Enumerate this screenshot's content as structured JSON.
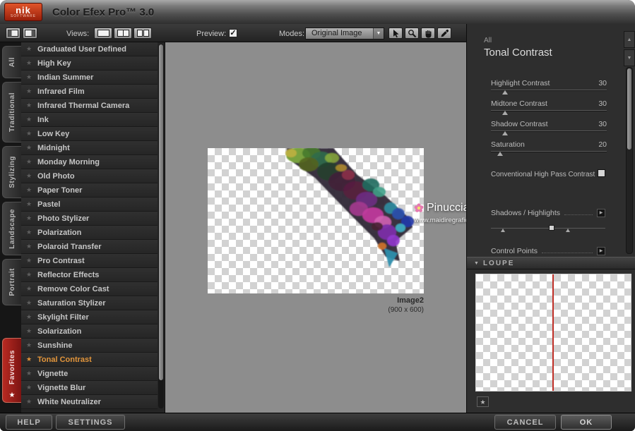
{
  "titlebar": {
    "logo_main": "nik",
    "logo_sub": "software",
    "title": "Color Efex Pro™ 3.0"
  },
  "toolbar": {
    "views_label": "Views:",
    "preview_label": "Preview:",
    "modes_label": "Modes:",
    "modes_value": "Original Image"
  },
  "icons": {
    "star": "★",
    "check": "✓",
    "chevron_down": "▼",
    "triangle_up": "▲",
    "triangle_down": "▼",
    "arrow_right": "▶"
  },
  "tabs": [
    "All",
    "Traditional",
    "Stylizing",
    "Landscape",
    "Portrait",
    "Favorites"
  ],
  "filter_list": {
    "selected_index": 22,
    "items": [
      "Graduated User Defined",
      "High Key",
      "Indian Summer",
      "Infrared Film",
      "Infrared Thermal Camera",
      "Ink",
      "Low Key",
      "Midnight",
      "Monday Morning",
      "Old Photo",
      "Paper Toner",
      "Pastel",
      "Photo Stylizer",
      "Polarization",
      "Polaroid Transfer",
      "Pro Contrast",
      "Reflector Effects",
      "Remove Color Cast",
      "Saturation Stylizer",
      "Skylight Filter",
      "Solarization",
      "Sunshine",
      "Tonal Contrast",
      "Vignette",
      "Vignette Blur",
      "White Neutralizer"
    ]
  },
  "preview": {
    "caption_name": "Image2",
    "caption_size": "(900 x 600)",
    "watermark_name": "Pinuccia",
    "watermark_url": "www.maidiregrafica.eu"
  },
  "settings": {
    "category": "All",
    "filter_name": "Tonal Contrast",
    "sliders": [
      {
        "label": "Highlight Contrast",
        "value": "30",
        "pos": "12%"
      },
      {
        "label": "Midtone Contrast",
        "value": "30",
        "pos": "12%"
      },
      {
        "label": "Shadow Contrast",
        "value": "30",
        "pos": "12%"
      },
      {
        "label": "Saturation",
        "value": "20",
        "pos": "8%"
      }
    ],
    "checkbox_label": "Conventional High Pass Contrast",
    "section_shadows": "Shadows / Highlights",
    "section_control_points": "Control Points",
    "loupe_label": "LOUPE"
  },
  "footer": {
    "help": "HELP",
    "settings": "SETTINGS",
    "cancel": "CANCEL",
    "ok": "OK"
  },
  "colors": {
    "selected_filter": "#e2953b",
    "favorites_tab": "#a82019",
    "loupe_line": "#c03028"
  }
}
